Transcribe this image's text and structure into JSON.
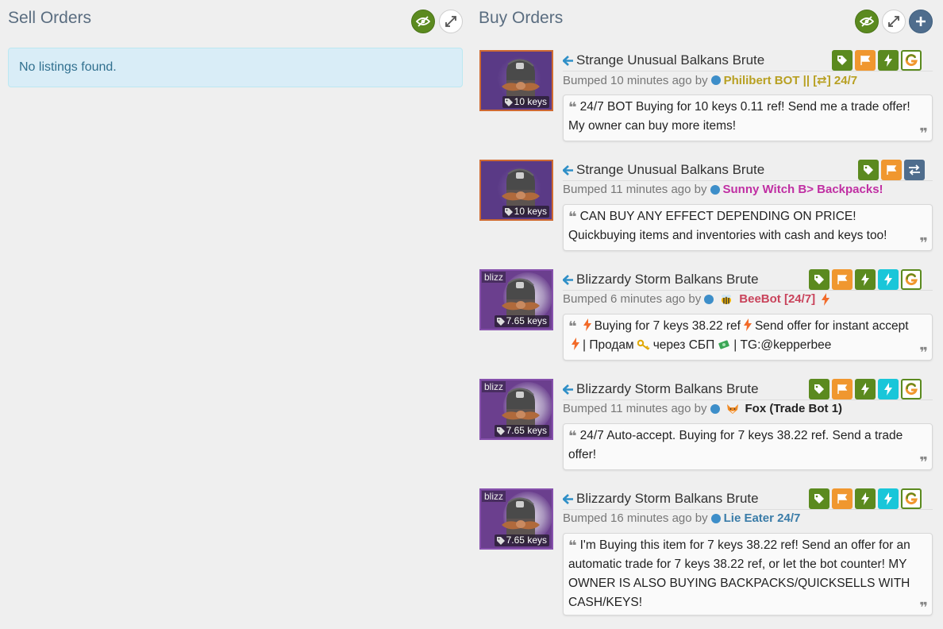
{
  "sell": {
    "title": "Sell Orders",
    "empty_message": "No listings found."
  },
  "buy": {
    "title": "Buy Orders"
  },
  "listings": [
    {
      "name": "Strange Unusual Balkans Brute",
      "price": "10 keys",
      "effect": "",
      "bumped": "Bumped 10 minutes ago by",
      "user": "Philibert BOT || [⇄] 24/7",
      "user_color": "#b8a022",
      "comment": "24/7 BOT Buying for 10 keys 0.11 ref! Send me a trade offer! My owner can buy more items!",
      "icons": [
        "tag-icon",
        "flag-icon",
        "bolt-icon",
        "g-icon"
      ]
    },
    {
      "name": "Strange Unusual Balkans Brute",
      "price": "10 keys",
      "effect": "",
      "bumped": "Bumped 11 minutes ago by",
      "user": "Sunny Witch B> Backpacks!",
      "user_color": "#c02fa3",
      "comment": "CAN BUY ANY EFFECT DEPENDING ON PRICE! Quickbuying items and inventories with cash and keys too!",
      "icons": [
        "tag-icon",
        "flag-icon",
        "swap-icon"
      ]
    },
    {
      "name": "Blizzardy Storm Balkans Brute",
      "price": "7.65 keys",
      "effect": "blizz",
      "bumped": "Bumped 6 minutes ago by",
      "user": "BeeBot [24/7]",
      "user_color": "#c9435b",
      "comment_parts": [
        "Buying for 7 keys 38.22 ref",
        "Send offer for instant accept",
        "| Продам",
        "через СБП",
        "| TG:@kepperbee"
      ],
      "icons": [
        "tag-icon",
        "flag-icon",
        "bolt-icon",
        "cyan-bolt-icon",
        "g-icon"
      ]
    },
    {
      "name": "Blizzardy Storm Balkans Brute",
      "price": "7.65 keys",
      "effect": "blizz",
      "bumped": "Bumped 11 minutes ago by",
      "user": "Fox (Trade Bot 1)",
      "user_color": "#222222",
      "comment": "24/7 Auto-accept. Buying for 7 keys 38.22 ref. Send a trade offer!",
      "icons": [
        "tag-icon",
        "flag-icon",
        "bolt-icon",
        "cyan-bolt-icon",
        "g-icon"
      ]
    },
    {
      "name": "Blizzardy Storm Balkans Brute",
      "price": "7.65 keys",
      "effect": "blizz",
      "bumped": "Bumped 16 minutes ago by",
      "user": "Lie Eater 24/7",
      "user_color": "#3a7ca8",
      "comment": "I'm Buying this item for 7 keys 38.22 ref! Send an offer for an automatic trade for 7 keys 38.22 ref, or let the bot counter! MY OWNER IS ALSO BUYING BACKPACKS/QUICKSELLS WITH CASH/KEYS!",
      "icons": [
        "tag-icon",
        "flag-icon",
        "bolt-icon",
        "cyan-bolt-icon",
        "g-icon"
      ]
    }
  ],
  "colors": {
    "green": "#5b8a1f",
    "orange": "#f0972f",
    "cyan": "#19c6d9",
    "slate": "#4f6d8d",
    "unusual_border": "#8650ac",
    "strange_border": "#cf6a32"
  }
}
